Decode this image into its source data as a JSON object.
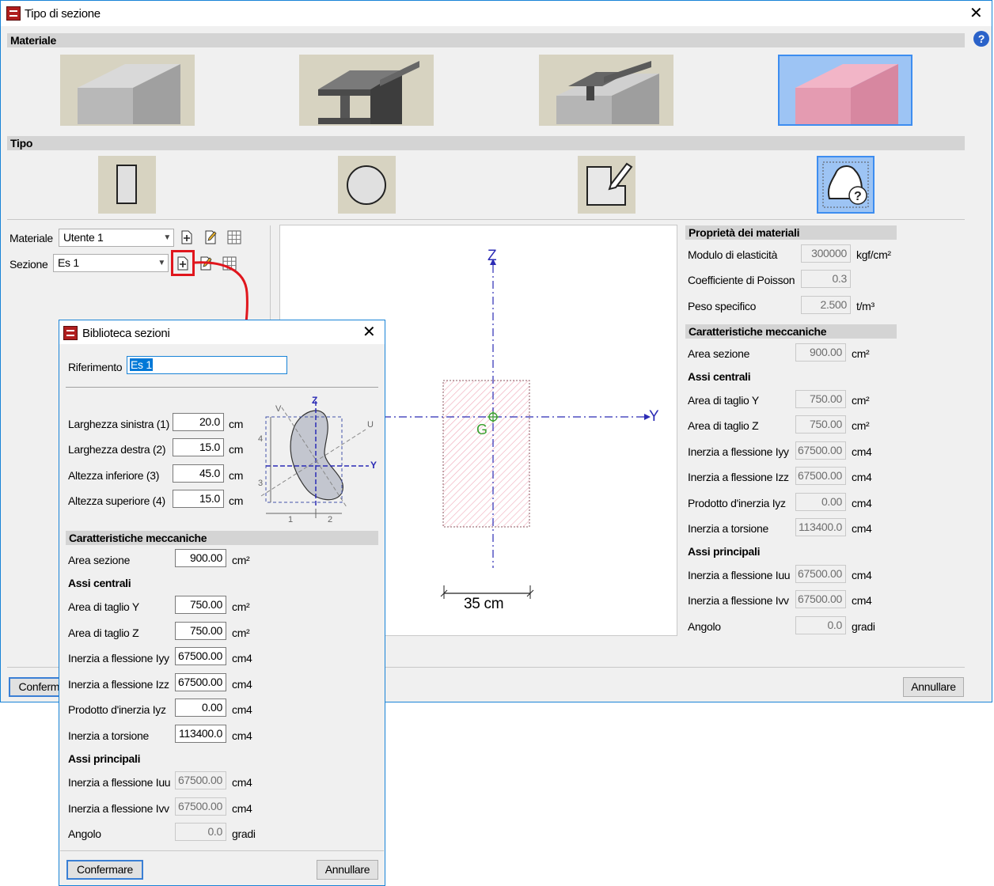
{
  "window": {
    "title": "Tipo di sezione"
  },
  "sections": {
    "materiale": "Materiale",
    "tipo": "Tipo"
  },
  "material_tiles": [
    "concrete-block",
    "steel-section",
    "composite-section",
    "generic-material"
  ],
  "type_tiles": [
    "rectangle",
    "circle",
    "polygon-edit",
    "generic-shape"
  ],
  "left_panel": {
    "materiale_label": "Materiale",
    "materiale_value": "Utente 1",
    "sezione_label": "Sezione",
    "sezione_value": "Es 1"
  },
  "drawing": {
    "axis_z": "Z",
    "axis_y": "Y",
    "centroid": "G",
    "dimension": "35 cm"
  },
  "properties": {
    "materials_header": "Proprietà dei materiali",
    "modulo_label": "Modulo di elasticità",
    "modulo_value": "300000",
    "modulo_unit": "kgf/cm²",
    "poisson_label": "Coefficiente di Poisson",
    "poisson_value": "0.3",
    "peso_label": "Peso specifico",
    "peso_value": "2.500",
    "peso_unit": "t/m³",
    "mech_header": "Caratteristiche meccaniche",
    "area_label": "Area sezione",
    "area_value": "900.00",
    "area_unit": "cm²",
    "central_header": "Assi centrali",
    "tagliy_label": "Area di taglio Y",
    "tagliy_value": "750.00",
    "tagliy_unit": "cm²",
    "tagliz_label": "Area di taglio Z",
    "tagliz_value": "750.00",
    "tagliz_unit": "cm²",
    "iyy_label": "Inerzia a flessione Iyy",
    "iyy_value": "67500.00",
    "iyy_unit": "cm4",
    "izz_label": "Inerzia a flessione Izz",
    "izz_value": "67500.00",
    "izz_unit": "cm4",
    "iyz_label": "Prodotto d'inerzia Iyz",
    "iyz_value": "0.00",
    "iyz_unit": "cm4",
    "tors_label": "Inerzia a torsione",
    "tors_value": "113400.0",
    "tors_unit": "cm4",
    "principal_header": "Assi principali",
    "iuu_label": "Inerzia a flessione Iuu",
    "iuu_value": "67500.00",
    "iuu_unit": "cm4",
    "ivv_label": "Inerzia a flessione Ivv",
    "ivv_value": "67500.00",
    "ivv_unit": "cm4",
    "angolo_label": "Angolo",
    "angolo_value": "0.0",
    "angolo_unit": "gradi"
  },
  "buttons": {
    "confirm": "Confermare",
    "cancel": "Annullare"
  },
  "dialog": {
    "title": "Biblioteca sezioni",
    "riferimento_label": "Riferimento",
    "riferimento_value": "Es 1",
    "larg_sx_label": "Larghezza sinistra (1)",
    "larg_sx_value": "20.0",
    "larg_dx_label": "Larghezza destra (2)",
    "larg_dx_value": "15.0",
    "alt_inf_label": "Altezza inferiore (3)",
    "alt_inf_value": "45.0",
    "alt_sup_label": "Altezza superiore (4)",
    "alt_sup_value": "15.0",
    "unit_cm": "cm",
    "diagram": {
      "v": "V",
      "z": "Z",
      "u": "U",
      "y": "Y",
      "d4": "4",
      "d3": "3",
      "d1": "1",
      "d2": "2"
    },
    "mech_header": "Caratteristiche meccaniche",
    "area_label": "Area sezione",
    "area_value": "900.00",
    "area_unit": "cm²",
    "central_header": "Assi centrali",
    "tagliy_label": "Area di taglio Y",
    "tagliy_value": "750.00",
    "tagliy_unit": "cm²",
    "tagliz_label": "Area di taglio Z",
    "tagliz_value": "750.00",
    "tagliz_unit": "cm²",
    "iyy_label": "Inerzia a flessione Iyy",
    "iyy_value": "67500.00",
    "iyy_unit": "cm4",
    "izz_label": "Inerzia a flessione Izz",
    "izz_value": "67500.00",
    "izz_unit": "cm4",
    "iyz_label": "Prodotto d'inerzia Iyz",
    "iyz_value": "0.00",
    "iyz_unit": "cm4",
    "tors_label": "Inerzia a torsione",
    "tors_value": "113400.0",
    "tors_unit": "cm4",
    "principal_header": "Assi principali",
    "iuu_label": "Inerzia a flessione Iuu",
    "iuu_value": "67500.00",
    "iuu_unit": "cm4",
    "ivv_label": "Inerzia a flessione Ivv",
    "ivv_value": "67500.00",
    "ivv_unit": "cm4",
    "angolo_label": "Angolo",
    "angolo_value": "0.0",
    "angolo_unit": "gradi",
    "confirm": "Confermare",
    "cancel": "Annullare"
  },
  "colors": {
    "accent": "#1883d7",
    "selected_tile": "#9dc4f4",
    "highlight": "#e0161d",
    "axis": "#2b2bb5",
    "centroid": "#3aa02f",
    "hatch": "#f0a8b8"
  }
}
